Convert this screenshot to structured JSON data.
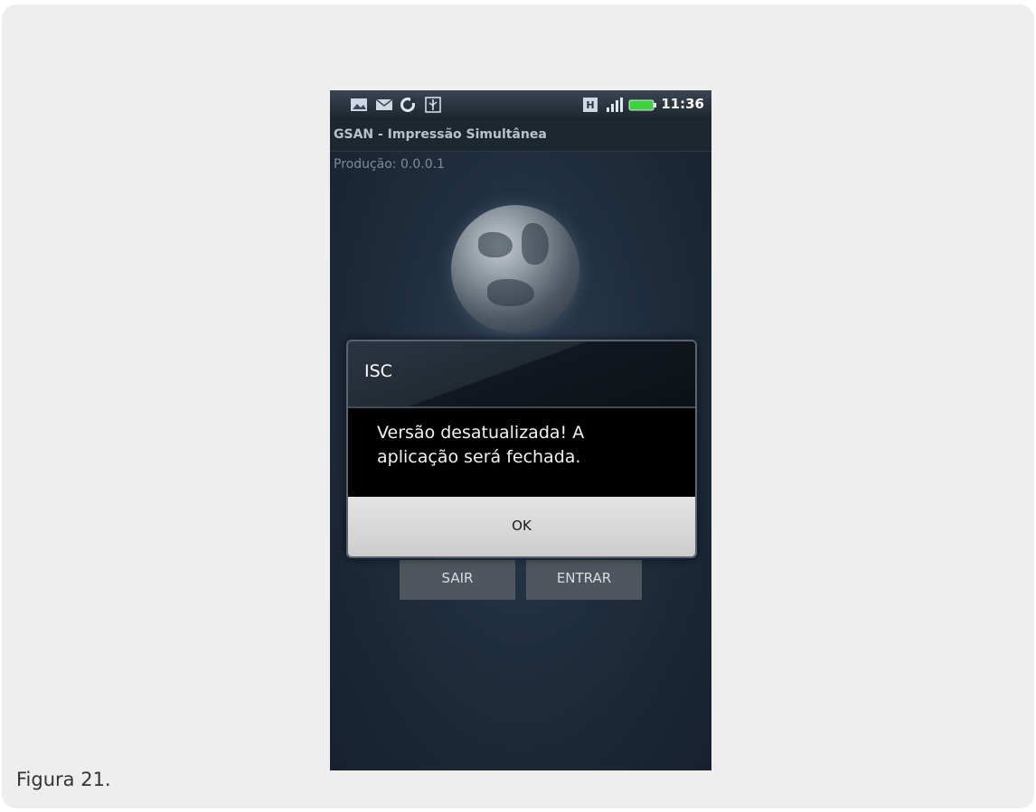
{
  "caption": "Figura 21.",
  "status_bar": {
    "time": "11:36",
    "icons": [
      "image-icon",
      "mail-icon",
      "sync-icon",
      "usb-icon",
      "sim-icon",
      "signal-icon",
      "battery-icon"
    ],
    "battery_color": "#3fd23f"
  },
  "app": {
    "title": "GSAN - Impressão Simultânea",
    "version": "Produção: 0.0.0.1",
    "buttons": {
      "exit_label": "SAIR",
      "enter_label": "ENTRAR"
    }
  },
  "dialog": {
    "title": "ISC",
    "message_line1": "Versão desatualizada! A",
    "message_line2": "aplicação será fechada.",
    "ok_label": "OK"
  }
}
